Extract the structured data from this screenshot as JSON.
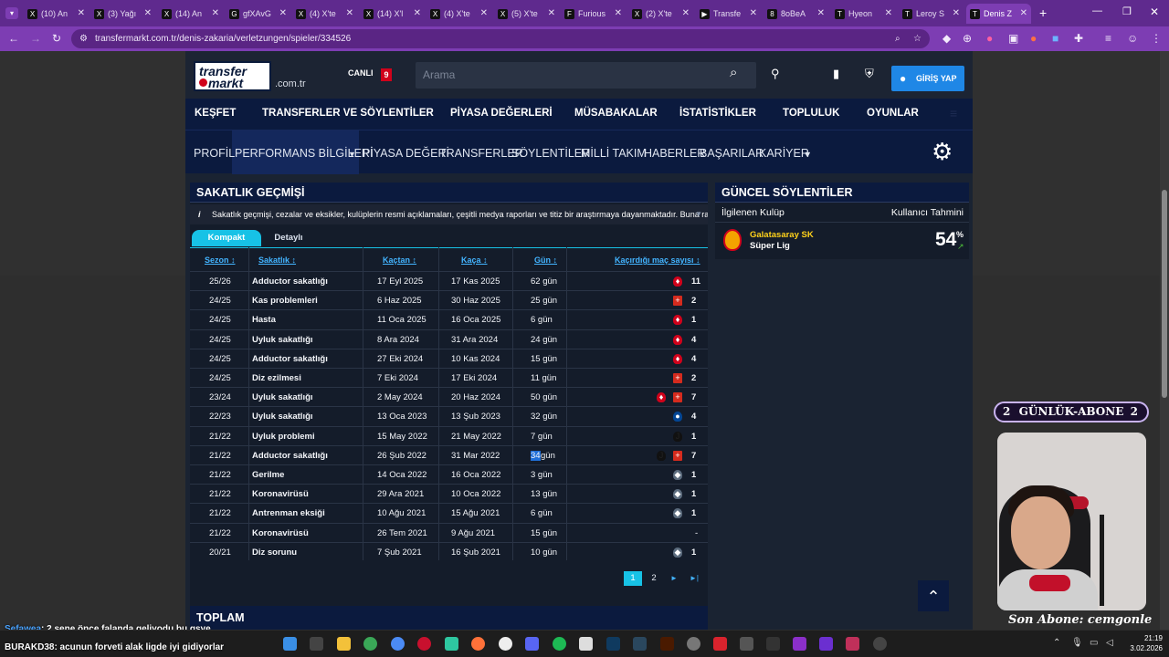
{
  "browser": {
    "tabs": [
      {
        "icon": "X",
        "title": "(10) An"
      },
      {
        "icon": "X",
        "title": "(3) Yağı"
      },
      {
        "icon": "X",
        "title": "(14) An"
      },
      {
        "icon": "G",
        "title": "gfXAvG"
      },
      {
        "icon": "X",
        "title": "(4) X'te"
      },
      {
        "icon": "X",
        "title": "(14) X'l"
      },
      {
        "icon": "X",
        "title": "(4) X'te"
      },
      {
        "icon": "X",
        "title": "(5) X'te"
      },
      {
        "icon": "F",
        "title": "Furious"
      },
      {
        "icon": "X",
        "title": "(2) X'te"
      },
      {
        "icon": "▶",
        "title": "Transfe"
      },
      {
        "icon": "8",
        "title": "8oBeA"
      },
      {
        "icon": "T",
        "title": "Hyeon"
      },
      {
        "icon": "T",
        "title": "Leroy S"
      },
      {
        "icon": "T",
        "title": "Denis Z"
      }
    ],
    "url": "transfermarkt.com.tr/denis-zakaria/verletzungen/spieler/334526"
  },
  "site": {
    "logo_top": "transfer",
    "logo_bottom": "markt",
    "domain": ".com.tr",
    "live_label": "CANLI",
    "live_count": "9",
    "search_placeholder": "Arama",
    "login_label": "GİRİŞ YAP",
    "main_nav": [
      "KEŞFET",
      "TRANSFERLER VE SÖYLENTİLER",
      "PİYASA DEĞERLERİ",
      "MÜSABAKALAR",
      "İSTATİSTİKLER",
      "TOPLULUK",
      "OYUNLAR"
    ],
    "sub_nav": [
      "PROFİL",
      "PERFORMANS BİLGİLERİ",
      "PİYASA DEĞERİ",
      "TRANSFERLER",
      "SÖYLENTİLER",
      "MİLLİ TAKIM",
      "HABERLER",
      "BAŞARILAR",
      "KARİYER"
    ],
    "sub_nav_active": "PERFORMANS BİLGİLERİ"
  },
  "injuries": {
    "title": "SAKATLIK GEÇMİŞİ",
    "info": "Sakatlık geçmişi, cezalar ve eksikler, kulüplerin resmi açıklamaları, çeşitli medya raporları ve titiz bir araştırmaya dayanmaktadır. Buna rağme...",
    "tabs": [
      "Kompakt",
      "Detaylı"
    ],
    "active_tab": "Kompakt",
    "columns": [
      "Sezon",
      "Sakatlık",
      "Kaçtan",
      "Kaça",
      "Gün",
      "Kaçırdığı maç sayısı"
    ],
    "rows": [
      {
        "season": "25/26",
        "injury": "Adductor sakatlığı",
        "from": "17 Eyl 2025",
        "until": "17 Kas 2025",
        "days": "62 gün",
        "clubs": [
          "monaco-crest"
        ],
        "games": "11"
      },
      {
        "season": "24/25",
        "injury": "Kas problemleri",
        "from": "6 Haz 2025",
        "until": "30 Haz 2025",
        "days": "25 gün",
        "clubs": [
          "swiss-flag"
        ],
        "games": "2"
      },
      {
        "season": "24/25",
        "injury": "Hasta",
        "from": "11 Oca 2025",
        "until": "16 Oca 2025",
        "days": "6 gün",
        "clubs": [
          "monaco-crest"
        ],
        "games": "1"
      },
      {
        "season": "24/25",
        "injury": "Uyluk sakatlığı",
        "from": "8 Ara 2024",
        "until": "31 Ara 2024",
        "days": "24 gün",
        "clubs": [
          "monaco-crest"
        ],
        "games": "4"
      },
      {
        "season": "24/25",
        "injury": "Adductor sakatlığı",
        "from": "27 Eki 2024",
        "until": "10 Kas 2024",
        "days": "15 gün",
        "clubs": [
          "monaco-crest"
        ],
        "games": "4"
      },
      {
        "season": "24/25",
        "injury": "Diz ezilmesi",
        "from": "7 Eki 2024",
        "until": "17 Eki 2024",
        "days": "11 gün",
        "clubs": [
          "swiss-flag"
        ],
        "games": "2"
      },
      {
        "season": "23/24",
        "injury": "Uyluk sakatlığı",
        "from": "2 May 2024",
        "until": "20 Haz 2024",
        "days": "50 gün",
        "clubs": [
          "monaco-crest",
          "swiss-flag"
        ],
        "games": "7"
      },
      {
        "season": "22/23",
        "injury": "Uyluk sakatlığı",
        "from": "13 Oca 2023",
        "until": "13 Şub 2023",
        "days": "32 gün",
        "clubs": [
          "chelsea-crest"
        ],
        "games": "4"
      },
      {
        "season": "21/22",
        "injury": "Uyluk problemi",
        "from": "15 May 2022",
        "until": "21 May 2022",
        "days": "7 gün",
        "clubs": [
          "juventus-crest"
        ],
        "games": "1"
      },
      {
        "season": "21/22",
        "injury": "Adductor sakatlığı",
        "from": "26 Şub 2022",
        "until": "31 Mar 2022",
        "days_highlight": "34",
        "days_rest": " gün",
        "clubs": [
          "juventus-crest",
          "swiss-flag"
        ],
        "games": "7"
      },
      {
        "season": "21/22",
        "injury": "Gerilme",
        "from": "14 Oca 2022",
        "until": "16 Oca 2022",
        "days": "3 gün",
        "clubs": [
          "gladbach-crest"
        ],
        "games": "1"
      },
      {
        "season": "21/22",
        "injury": "Koronavirüsü",
        "from": "29 Ara 2021",
        "until": "10 Oca 2022",
        "days": "13 gün",
        "clubs": [
          "gladbach-crest"
        ],
        "games": "1"
      },
      {
        "season": "21/22",
        "injury": "Antrenman eksiği",
        "from": "10 Ağu 2021",
        "until": "15 Ağu 2021",
        "days": "6 gün",
        "clubs": [
          "gladbach-crest"
        ],
        "games": "1"
      },
      {
        "season": "21/22",
        "injury": "Koronavirüsü",
        "from": "26 Tem 2021",
        "until": "9 Ağu 2021",
        "days": "15 gün",
        "clubs": [],
        "games": "-"
      },
      {
        "season": "20/21",
        "injury": "Diz sorunu",
        "from": "7 Şub 2021",
        "until": "16 Şub 2021",
        "days": "10 gün",
        "clubs": [
          "gladbach-crest"
        ],
        "games": "1"
      }
    ],
    "pagination": {
      "pages": [
        "1",
        "2"
      ],
      "current": "1",
      "next": "►",
      "last": "►|"
    }
  },
  "total": {
    "title": "TOPLAM"
  },
  "rumors": {
    "title": "GÜNCEL SÖYLENTİLER",
    "col_left": "İlgilenen Kulüp",
    "col_right": "Kullanıcı Tahmini",
    "club": "Galatasaray SK",
    "league": "Süper Lig",
    "percent": "54",
    "percent_sign": "%"
  },
  "overlay": {
    "subs_label": "GÜNLÜK-ABONE",
    "subs_left": "2",
    "subs_right": "2",
    "last_sub": "Son Abone: cemgonle",
    "chat": [
      {
        "user": "Sefawea",
        "msg": ": 2 sene önce falanda geliyodu bu gsye"
      },
      {
        "user": "BURAKD38",
        "msg": ": acunun forveti alak ligde iyi gidiyorlar"
      }
    ]
  },
  "clock": {
    "time": "21:19",
    "date": "3.02.2026"
  }
}
